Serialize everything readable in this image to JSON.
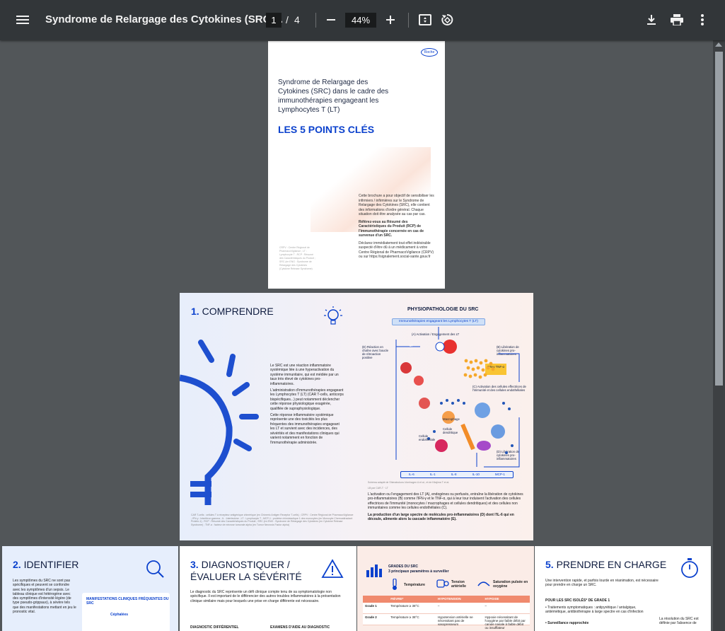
{
  "toolbar": {
    "menu_icon": "hamburger-menu-icon",
    "title": "Syndrome de Relargage des Cytokines (SRC)...",
    "page_current": "1",
    "page_separator": "/",
    "page_total": "4",
    "zoom_out_icon": "minus-icon",
    "zoom_value": "44%",
    "zoom_in_icon": "plus-icon",
    "fit_page_icon": "fit-to-page-icon",
    "rotate_icon": "rotate-icon",
    "download_icon": "download-icon",
    "print_icon": "print-icon",
    "more_icon": "more-vert-icon"
  },
  "page1": {
    "logo": "Roche",
    "heading": "Syndrome de Relargage des Cytokines (SRC) dans le cadre des immunothérapies engageant les Lymphocytes T (LT)",
    "big_title": "LES 5 POINTS CLÉS",
    "body1": "Cette brochure a pour objectif de sensibiliser les infirmiers / infirmières sur le Syndrome de Relargage des Cytokines (SRC), elle contient des informations d'ordre général. Chaque situation doit être analysée au cas par cas.",
    "body2": "Référez-vous au Résumé des Caractéristiques du Produit (RCP) de l'immunothérapie concernée en cas de survenue d'un SRC.",
    "body3": "Déclarez immédiatement tout effet indésirable suspecté d'être dû à un médicament à votre Centre Régional de PharmacoVigilance (CRPV) ou sur https://signalement.social-sante.gouv.fr",
    "side": "CRPV : Centre Régional de PharmacoVigilance ; LT : Lymphocyte T ; RCP : Résumé des Caractéristiques du Produit ; SRC (en ENG : Syndrome de Relargage des Cytokines (Cytokine Release Syndrome)"
  },
  "page2": {
    "section_num": "1.",
    "section_title": "COMPRENDRE",
    "text1": "Le SRC est une réaction inflammatoire systémique liée à une hyperactivation du système immunitaire, qui est médiée par un taux très élevé de cytokines pro-inflammatoires.",
    "text2": "L'administration d'immunothérapies engageant les Lymphocytes T (LT) (CAR T-cells, anticorps bispécifiques...) peut notamment déclencher cette réponse physiologique exagérée, qualifiée de supraphysiologique.",
    "text3": "Cette réponse inflammatoire systémique représente une des toxicités les plus fréquentes des immunothérapies engageant les LT et survient avec des incidences, des sévérités et des manifestations cliniques qui varient notamment en fonction de l'immunothérapie administrée.",
    "footnote": "CAR T-cells : cellules T à récepteur antigénique chimérique (en Chimeric Antigen Receptor T-cells) ; CRPV : Centre Régional de PharmacoVigilance ; IFN-γ : Interféron gamma ; IL : Interleukine ; LT : Lymphocyte T ; MCP-1 : protéine chimiotactique 1 des monocytes (en Monocyte Chemoattractant Protein-1) ; RCP : Résumé des Caractéristiques du Produit ; SRC (en ENG : Syndrome de Relargage des Cytokines (en Cytokine Release Syndrome) ; TNF-α : facteur de nécrose tumorale alpha (en Tumor Necrosis Factor alpha)",
    "diagram_title": "PHYSIOPATHOLOGIE DU SRC",
    "pill": "Immunothérapies engageant les Lymphocytes T (LT)",
    "label_a": "(A) Activation / Engagement des LT",
    "label_b": "(B) Libération de cytokines pro-inflammatoires",
    "label_c": "(C) Activation des cellules effectrices de l'immunité et des cellules endothéliales",
    "label_d": "(D) Libération de cytokines pro-inflammatoires",
    "label_e": "(E) Réaction en chaîne avec boucle de rétroaction positive",
    "ifn": "IFN-γ TNF-α",
    "macrophage": "Macrophage",
    "cellule_dendritique": "Cellule dendritique",
    "cellule_endo": "Cellule endothéliale",
    "lt": "LT",
    "cytokines": [
      "IL-6",
      "IL-1",
      "IL-8",
      "IL-10",
      "MCP-1"
    ],
    "schema_note": "Schéma adapté de Shimabukuro-Vornhagen A et al., et de Kitajima T et al.",
    "legend1": "LB par CAR-T",
    "legend2": "LT",
    "rt1": "L'activation ou l'engagement des LT (A), endogènes ou perfusés, entraîne la libération de cytokines pro-inflammatoires (B) comme l'IFN-γ et le TNF-α, qui à leur tour induisent l'activation des cellules effectrices de l'immunité (monocytes / macrophages et cellules dendritiques) et des cellules non immunitaires comme les cellules endothéliales (C).",
    "rt2": "La production d'un large spectre de molécules pro-inflammatoires (D) dont l'IL-6 qui en découle, alimente alors la cascade inflammatoire (E)."
  },
  "row": {
    "s2_num": "2.",
    "s2_title": "IDENTIFIER",
    "s2_text": "Les symptômes du SRC ne sont pas spécifiques et peuvent se confondre avec les symptômes d'un sepsis. Le tableau clinique est hétérogène avec des symptômes d'intensité légère (de type pseudo-grippaux), à sévère tels que des manifestations mettant en jeu le pronostic vital.",
    "s2_card": "MANIFESTATIONS CLINIQUES FRÉQUENTES DU SRC",
    "s2_item": "Céphalées",
    "s3_num": "3.",
    "s3_title": "DIAGNOSTIQUER / ÉVALUER LA SÉVÉRITÉ",
    "s3_text": "Le diagnostic du SRC représente un défi clinique compte tenu de sa symptomatologie non spécifique. Il est important de le différencier des autres troubles inflammatoires à la présentation clinique similaire mais pour lesquels une prise en charge différente est nécessaire.",
    "s3_col1": "DIAGNOSTIC DIFFÉRENTIEL",
    "s3_col2": "EXAMENS D'AIDE AU DIAGNOSTIC",
    "grades_title": "GRADES DU SRC",
    "grades_sub": "3 principaux paramètres à surveiller",
    "param1": "Température",
    "param2": "Tension artérielle",
    "param3": "Saturation pulsée en oxygène",
    "table_headers": [
      "",
      "FIÈVRE*",
      "HYPOTENSION",
      "HYPOXIE"
    ],
    "table_rows": [
      [
        "Grade 1",
        "Température ≥ 38°C",
        "–",
        "–"
      ],
      [
        "Grade 2",
        "Température ≥ 38°C",
        "Hypotension artérielle ne nécessitant pas de vasopresseurs",
        "Hypoxie nécessitant de l'oxygène par faible débit par canule nasale à faible débit ou insufflateur"
      ]
    ],
    "s5_num": "5.",
    "s5_title": "PRENDRE EN CHARGE",
    "s5_text": "Une intervention rapide, et parfois lourde en réanimation, est nécessaire pour prendre en charge un SRC.",
    "s5_sub": "POUR LES SRC ISOLÉS* DE GRADE 1",
    "s5_b1": "• Traitements symptomatiques : antipyrétique / antalgique, antiémétique, antibiothérapie à large spectre en cas d'infection",
    "s5_b2": "• Surveillance rapprochée",
    "s5_side": "La résolution du SRC est définie par l'absence de"
  }
}
